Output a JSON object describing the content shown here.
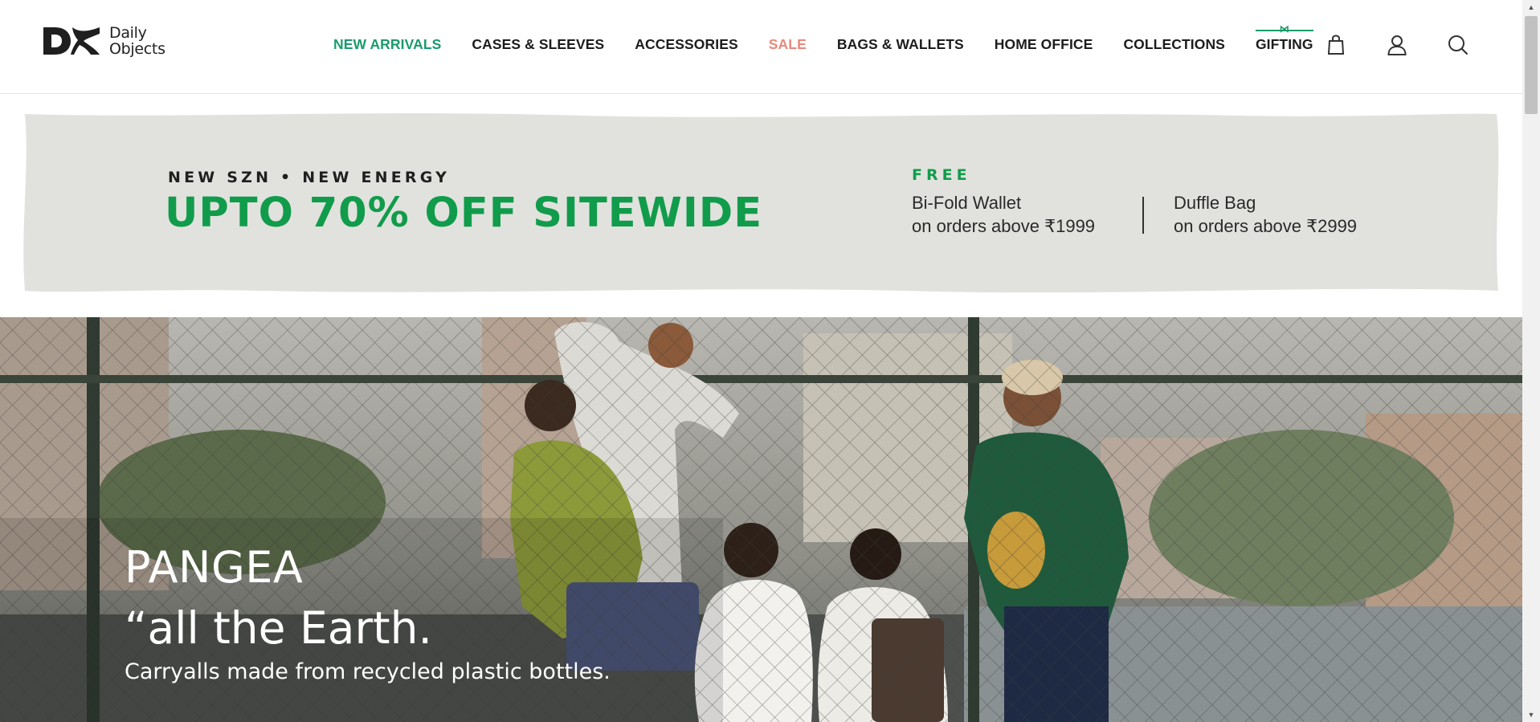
{
  "brand": {
    "name_line1": "Daily",
    "name_line2": "Objects",
    "mark_text": "DO"
  },
  "nav": {
    "items": [
      {
        "label": "NEW ARRIVALS",
        "color": "#1a9b6b"
      },
      {
        "label": "CASES & SLEEVES",
        "color": "#1d1d1d"
      },
      {
        "label": "ACCESSORIES",
        "color": "#1d1d1d"
      },
      {
        "label": "SALE",
        "color": "#e8897b"
      },
      {
        "label": "BAGS & WALLETS",
        "color": "#1d1d1d"
      },
      {
        "label": "HOME OFFICE",
        "color": "#1d1d1d"
      },
      {
        "label": "COLLECTIONS",
        "color": "#1d1d1d"
      },
      {
        "label": "GIFTING",
        "color": "#1d1d1d"
      }
    ]
  },
  "header_icons": [
    "bag-icon",
    "user-icon",
    "search-icon"
  ],
  "promo": {
    "kicker": "NEW SZN • NEW ENERGY",
    "headline": "UPTO 70% OFF SITEWIDE",
    "free_label": "FREE",
    "offers": [
      {
        "item": "Bi-Fold Wallet",
        "condition": "on orders above ₹1999"
      },
      {
        "item": "Duffle Bag",
        "condition": "on orders above ₹2999"
      }
    ],
    "background": "#e1e2de",
    "accent": "#119c4b"
  },
  "hero": {
    "title": "PANGEA",
    "quote": "“all the Earth.",
    "subtitle": "Carryalls made from recycled plastic bottles."
  }
}
